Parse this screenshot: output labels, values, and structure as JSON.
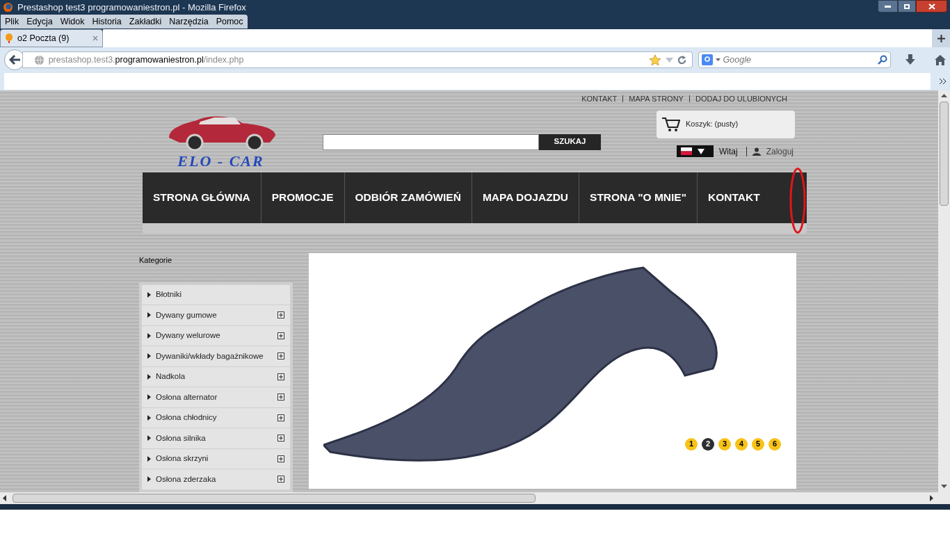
{
  "window": {
    "title": "Prestashop test3 programowaniestron.pl - Mozilla Firefox"
  },
  "menu": [
    "Plik",
    "Edycja",
    "Widok",
    "Historia",
    "Zakładki",
    "Narzędzia",
    "Pomoc"
  ],
  "tabs": [
    {
      "label": "o2 Poczta (9)",
      "selected": true
    }
  ],
  "address": {
    "prefix": "prestashop.test3.",
    "domain": "programowaniestron.pl",
    "path": "/index.php"
  },
  "search": {
    "placeholder": "Google"
  },
  "page": {
    "top_links": [
      "KONTAKT",
      "MAPA STRONY",
      "DODAJ DO ULUBIONYCH"
    ],
    "logo_text": "ELO - CAR",
    "search_button": "SZUKAJ",
    "cart": "Koszyk: (pusty)",
    "greeting": "Witaj",
    "login": "Zaloguj",
    "nav": [
      {
        "label": "STRONA GŁÓWNA"
      },
      {
        "label": "PROMOCJE"
      },
      {
        "label": "ODBIÓR ZAMÓWIEŃ"
      },
      {
        "label": "MAPA DOJAZDU"
      },
      {
        "label": "STRONA \"O MNIE\""
      },
      {
        "label": "KONTAKT"
      }
    ],
    "categories_title": "Kategorie",
    "categories": [
      {
        "label": "Błotniki",
        "expandable": false
      },
      {
        "label": "Dywany gumowe",
        "expandable": true
      },
      {
        "label": "Dywany welurowe",
        "expandable": true
      },
      {
        "label": "Dywaniki/wkłady bagażnikowe",
        "expandable": true
      },
      {
        "label": "Nadkola",
        "expandable": true
      },
      {
        "label": "Osłona alternator",
        "expandable": true
      },
      {
        "label": "Osłona chłodnicy",
        "expandable": true
      },
      {
        "label": "Osłona silnika",
        "expandable": true
      },
      {
        "label": "Osłona skrzyni",
        "expandable": true
      },
      {
        "label": "Osłona zderzaka",
        "expandable": true
      }
    ],
    "slides": [
      {
        "label": "1",
        "selected": false
      },
      {
        "label": "2",
        "selected": true
      },
      {
        "label": "3",
        "selected": false
      },
      {
        "label": "4",
        "selected": false
      },
      {
        "label": "5",
        "selected": false
      },
      {
        "label": "6",
        "selected": false
      }
    ]
  }
}
